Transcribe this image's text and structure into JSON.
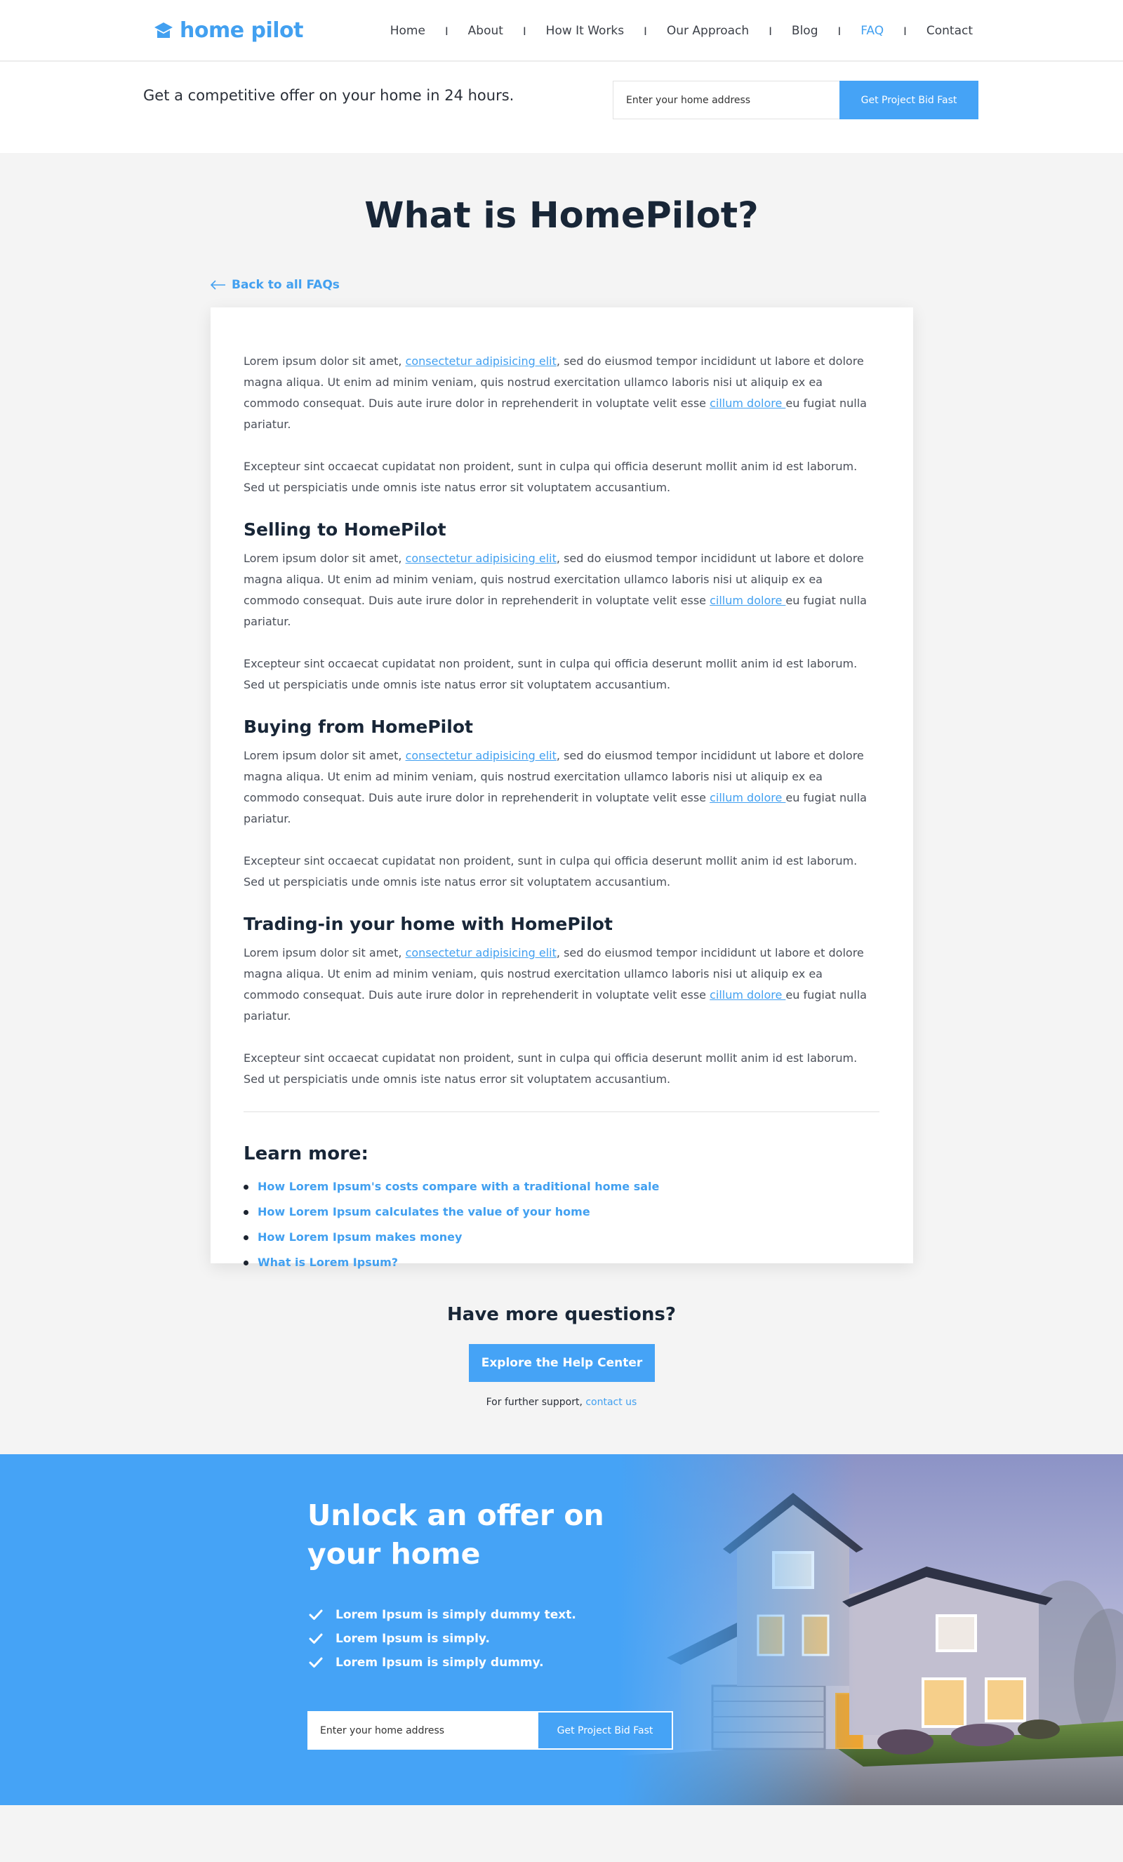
{
  "header": {
    "logo_text": "home pilot",
    "nav": [
      {
        "label": "Home",
        "active": false
      },
      {
        "label": "About",
        "active": false
      },
      {
        "label": "How It Works",
        "active": false
      },
      {
        "label": "Our Approach",
        "active": false
      },
      {
        "label": "Blog",
        "active": false
      },
      {
        "label": "FAQ",
        "active": true
      },
      {
        "label": "Contact",
        "active": false
      }
    ],
    "separator": "I"
  },
  "offer": {
    "text": "Get a competitive offer on your home in 24 hours.",
    "address_placeholder": "Enter your home address",
    "button_label": "Get Project Bid Fast"
  },
  "main": {
    "title": "What is HomePilot?",
    "back_link": "Back to all FAQs",
    "intro": {
      "p1": {
        "a": "Lorem ipsum dolor sit amet, ",
        "link1": "consectetur adipisicing elit",
        "b": ", sed do eiusmod tempor incididunt ut labore et dolore magna aliqua. Ut enim ad minim veniam, quis nostrud exercitation ullamco laboris nisi ut aliquip ex ea commodo consequat. Duis aute irure dolor in reprehenderit in voluptate velit esse ",
        "link2": "cillum dolore ",
        "c": "eu fugiat nulla pariatur."
      },
      "p2": "Excepteur sint occaecat cupidatat non proident, sunt in culpa qui officia deserunt mollit anim id est laborum. Sed ut perspiciatis unde omnis iste natus error sit voluptatem accusantium."
    },
    "sections": [
      {
        "heading": "Selling to HomePilot",
        "p1": {
          "a": "Lorem ipsum dolor sit amet, ",
          "link1": "consectetur adipisicing elit",
          "b": ", sed do eiusmod tempor incididunt ut labore et dolore magna aliqua. Ut enim ad minim veniam, quis nostrud exercitation ullamco laboris nisi ut aliquip ex ea commodo consequat. Duis aute irure dolor in reprehenderit in voluptate velit esse ",
          "link2": "cillum dolore ",
          "c": "eu fugiat nulla pariatur."
        },
        "p2": "Excepteur sint occaecat cupidatat non proident, sunt in culpa qui officia deserunt mollit anim id est laborum. Sed ut perspiciatis unde omnis iste natus error sit voluptatem accusantium."
      },
      {
        "heading": "Buying from HomePilot",
        "p1": {
          "a": "Lorem ipsum dolor sit amet, ",
          "link1": "consectetur adipisicing elit",
          "b": ", sed do eiusmod tempor incididunt ut labore et dolore magna aliqua. Ut enim ad minim veniam, quis nostrud exercitation ullamco laboris nisi ut aliquip ex ea commodo consequat. Duis aute irure dolor in reprehenderit in voluptate velit esse ",
          "link2": "cillum dolore ",
          "c": "eu fugiat nulla pariatur."
        },
        "p2": "Excepteur sint occaecat cupidatat non proident, sunt in culpa qui officia deserunt mollit anim id est laborum. Sed ut perspiciatis unde omnis iste natus error sit voluptatem accusantium."
      },
      {
        "heading": "Trading-in your home with HomePilot",
        "p1": {
          "a": "Lorem ipsum dolor sit amet, ",
          "link1": "consectetur adipisicing elit",
          "b": ", sed do eiusmod tempor incididunt ut labore et dolore magna aliqua. Ut enim ad minim veniam, quis nostrud exercitation ullamco laboris nisi ut aliquip ex ea commodo consequat. Duis aute irure dolor in reprehenderit in voluptate velit esse ",
          "link2": "cillum dolore ",
          "c": "eu fugiat nulla pariatur."
        },
        "p2": "Excepteur sint occaecat cupidatat non proident, sunt in culpa qui officia deserunt mollit anim id est laborum. Sed ut perspiciatis unde omnis iste natus error sit voluptatem accusantium."
      }
    ],
    "learn_more": {
      "heading": "Learn more:",
      "links": [
        "How Lorem Ipsum's costs compare with a traditional home sale",
        "How Lorem Ipsum calculates the value of your home",
        "How Lorem Ipsum makes money",
        "What is Lorem Ipsum?"
      ]
    }
  },
  "help": {
    "title": "Have more questions?",
    "button_label": "Explore the Help Center",
    "support_prefix": "For further support, ",
    "support_link": "contact us"
  },
  "banner": {
    "title": "Unlock an offer on your home",
    "benefits": [
      "Lorem Ipsum is simply dummy text.",
      "Lorem Ipsum is simply.",
      "Lorem Ipsum is simply dummy."
    ],
    "address_placeholder": "Enter your home address",
    "button_label": "Get Project Bid Fast"
  },
  "icons": {
    "logo": "house-cap-icon",
    "back": "arrow-left-icon",
    "benefit": "check-icon"
  },
  "colors": {
    "accent": "#42a0f0",
    "button": "#45a3f6",
    "heading": "#182637",
    "page_bg": "#f4f4f4"
  }
}
